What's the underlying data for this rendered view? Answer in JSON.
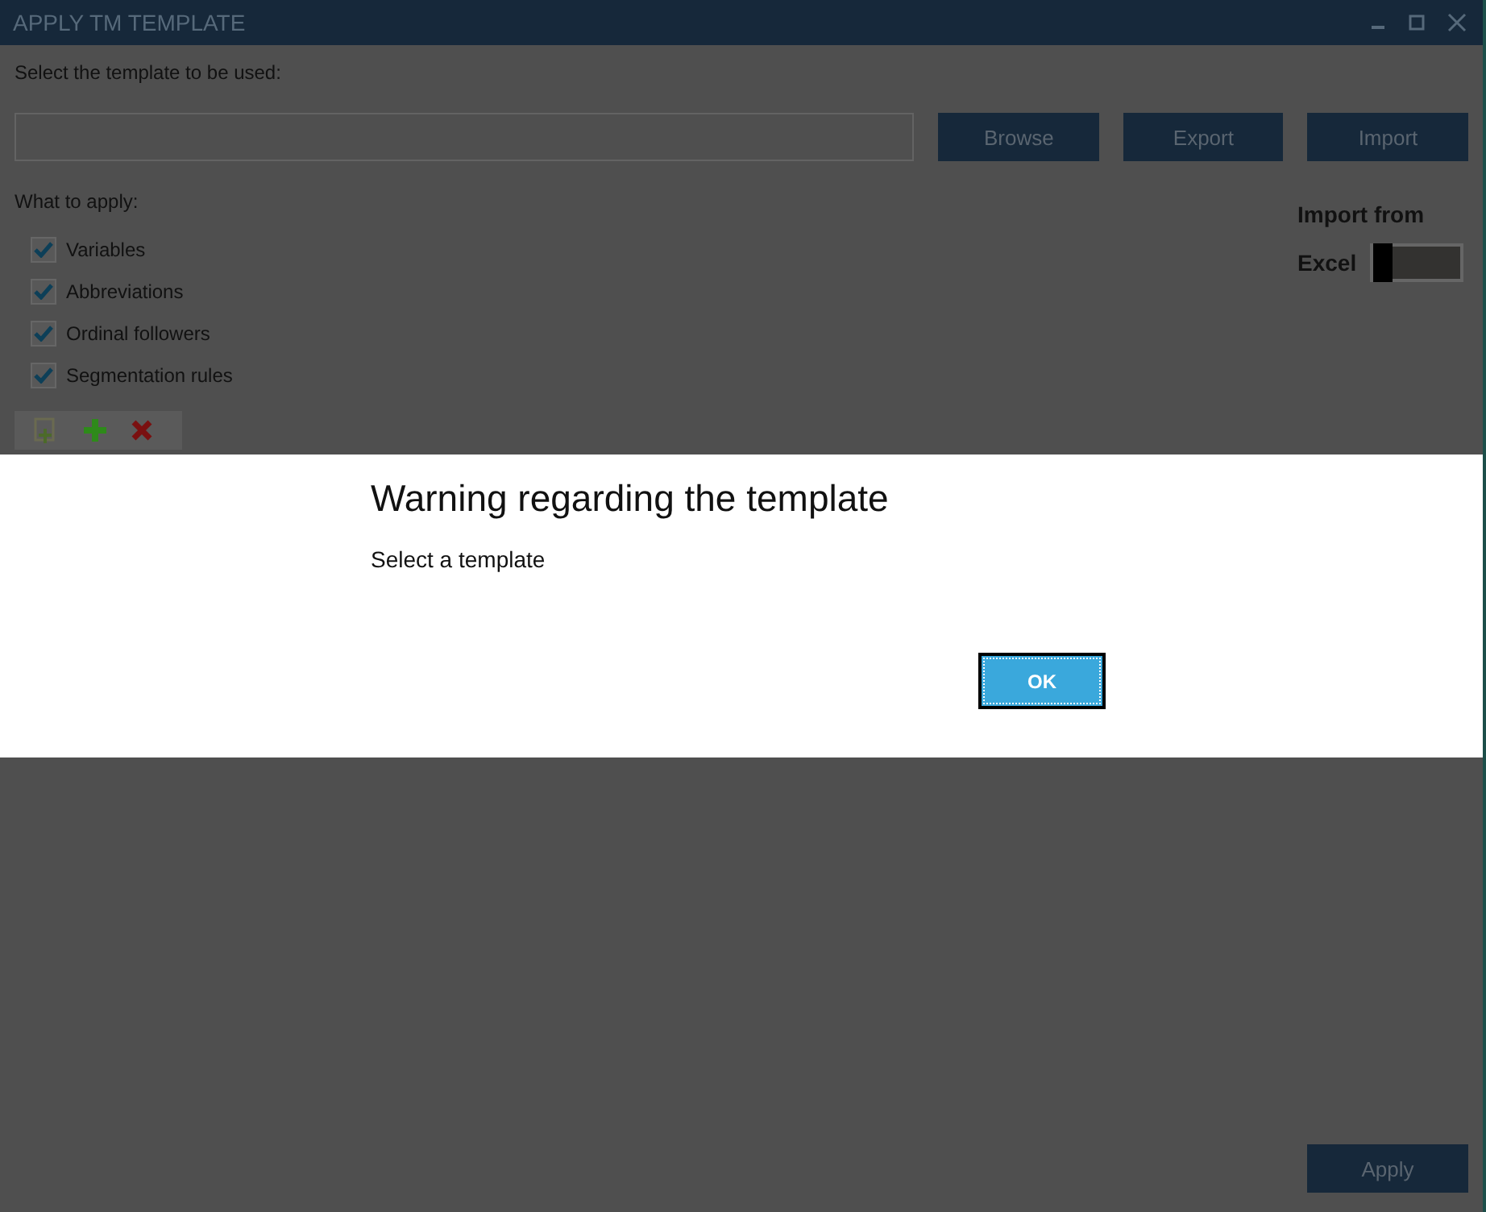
{
  "window": {
    "title": "APPLY TM TEMPLATE"
  },
  "template_label": "Select the template to be used:",
  "buttons": [
    "Browse",
    "Export",
    "Import"
  ],
  "import_from": {
    "label": "Import from",
    "option": "Excel",
    "on": false
  },
  "apply_label": "What to apply:",
  "options": [
    {
      "label": "Variables",
      "checked": true
    },
    {
      "label": "Abbreviations",
      "checked": true
    },
    {
      "label": "Ordinal followers",
      "checked": true
    },
    {
      "label": "Segmentation rules",
      "checked": true
    }
  ],
  "toolbar": [
    {
      "kind": "add-page"
    },
    {
      "kind": "add"
    },
    {
      "kind": "delete"
    }
  ],
  "dialog": {
    "title": "Warning regarding the template",
    "message": "Select a template",
    "button": "OK"
  },
  "apply_button": "Apply"
}
